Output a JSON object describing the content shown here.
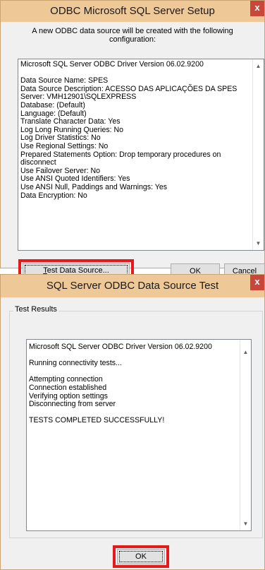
{
  "setup_dialog": {
    "title": "ODBC Microsoft SQL Server Setup",
    "close_label": "x",
    "intro_line1": "A new ODBC data source will be created with the following",
    "intro_line2": "configuration:",
    "config_lines": [
      "Microsoft SQL Server ODBC Driver Version 06.02.9200",
      "",
      "Data Source Name: SPES",
      "Data Source Description: ACESSO DAS APLICAÇÕES DA SPES",
      "Server: VMH12901\\SQLEXPRESS",
      "Database: (Default)",
      "Language: (Default)",
      "Translate Character Data: Yes",
      "Log Long Running Queries: No",
      "Log Driver Statistics: No",
      "Use Regional Settings: No",
      "Prepared Statements Option: Drop temporary procedures on",
      "disconnect",
      "Use Failover Server: No",
      "Use ANSI Quoted Identifiers: Yes",
      "Use ANSI Null, Paddings and Warnings: Yes",
      "Data Encryption: No"
    ],
    "test_button_mnemonic": "T",
    "test_button_rest": "est Data Source...",
    "ok_label": "OK",
    "cancel_label": "Cancel"
  },
  "test_dialog": {
    "title": "SQL Server ODBC Data Source Test",
    "close_label": "x",
    "group_label": "Test Results",
    "result_lines": [
      "Microsoft SQL Server ODBC Driver Version 06.02.9200",
      "",
      "Running connectivity tests...",
      "",
      "Attempting connection",
      "Connection established",
      "Verifying option settings",
      "Disconnecting from server",
      "",
      "TESTS COMPLETED SUCCESSFULLY!"
    ],
    "ok_label": "OK"
  },
  "icons": {
    "scroll_up": "▲",
    "scroll_down": "▼"
  }
}
